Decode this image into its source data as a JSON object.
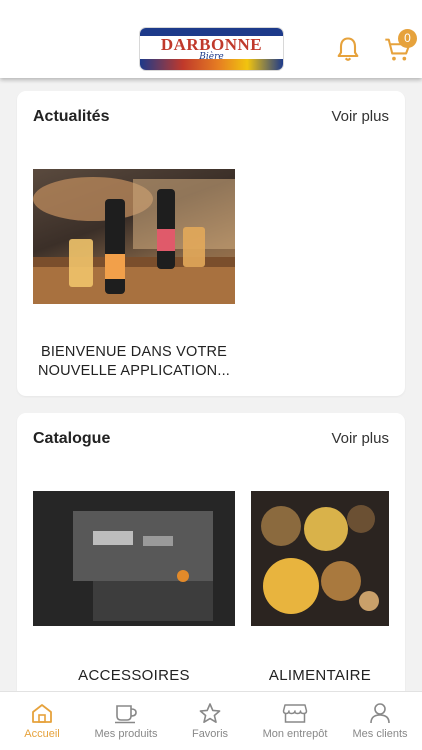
{
  "header": {
    "logo": {
      "word": "DARBONNE",
      "sub": "Bière"
    },
    "cart_count": "0",
    "accent": "#e6a23c"
  },
  "news": {
    "title": "Actualités",
    "more": "Voir plus",
    "items": [
      {
        "caption": "BIENVENUE DANS VOTRE NOUVELLE APPLICATION..."
      }
    ]
  },
  "catalogue": {
    "title": "Catalogue",
    "more": "Voir plus",
    "items": [
      {
        "caption": "ACCESSOIRES"
      },
      {
        "caption": "ALIMENTAIRE"
      }
    ]
  },
  "nav": {
    "items": [
      {
        "label": "Accueil",
        "icon": "home-icon",
        "active": true
      },
      {
        "label": "Mes produits",
        "icon": "cup-icon",
        "active": false
      },
      {
        "label": "Favoris",
        "icon": "star-icon",
        "active": false
      },
      {
        "label": "Mon entrepôt",
        "icon": "store-icon",
        "active": false
      },
      {
        "label": "Mes clients",
        "icon": "user-icon",
        "active": false
      }
    ]
  }
}
